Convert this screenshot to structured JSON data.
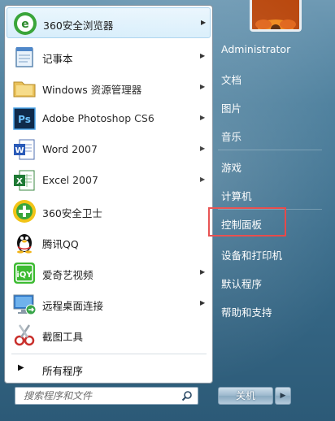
{
  "programs": [
    {
      "label": "360安全浏览器",
      "icon": "360-browser-icon",
      "has_submenu": true
    },
    {
      "label": "记事本",
      "icon": "notepad-icon",
      "has_submenu": true
    },
    {
      "label": "Windows 资源管理器",
      "icon": "explorer-folder-icon",
      "has_submenu": true
    },
    {
      "label": "Adobe Photoshop CS6",
      "icon": "photoshop-icon",
      "has_submenu": true
    },
    {
      "label": "Word 2007",
      "icon": "word-icon",
      "has_submenu": true
    },
    {
      "label": "Excel 2007",
      "icon": "excel-icon",
      "has_submenu": true
    },
    {
      "label": "360安全卫士",
      "icon": "360-security-icon",
      "has_submenu": false
    },
    {
      "label": "腾讯QQ",
      "icon": "qq-penguin-icon",
      "has_submenu": false
    },
    {
      "label": "爱奇艺视频",
      "icon": "iqiyi-icon",
      "has_submenu": true
    },
    {
      "label": "远程桌面连接",
      "icon": "remote-desktop-icon",
      "has_submenu": true
    },
    {
      "label": "截图工具",
      "icon": "snipping-tool-icon",
      "has_submenu": false
    }
  ],
  "all_programs": {
    "label": "所有程序"
  },
  "search": {
    "placeholder": "搜索程序和文件"
  },
  "user": {
    "name": "Administrator"
  },
  "right_links": {
    "documents": "文档",
    "pictures": "图片",
    "music": "音乐",
    "games": "游戏",
    "computer": "计算机",
    "control_panel": "控制面板",
    "devices_printers": "设备和打印机",
    "default_programs": "默认程序",
    "help_support": "帮助和支持"
  },
  "shutdown": {
    "label": "关机"
  },
  "colors": {
    "highlight": "#e53a3a",
    "selected_item": "#d8eefb"
  }
}
